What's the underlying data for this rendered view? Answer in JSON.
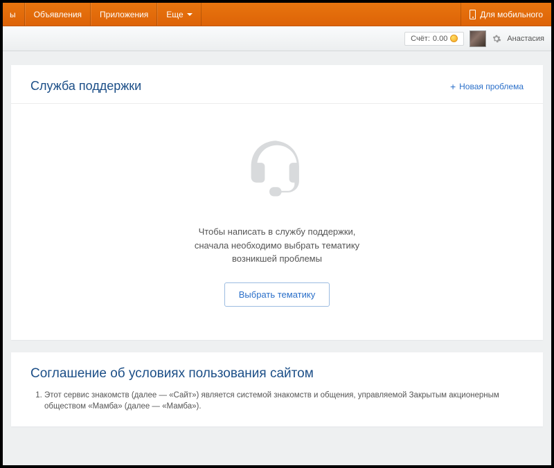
{
  "topnav": {
    "items": [
      "ы",
      "Объявления",
      "Приложения",
      "Еще"
    ],
    "mobile_label": "Для мобильного"
  },
  "userbar": {
    "balance_label": "Счёт:",
    "balance_value": "0.00",
    "username": "Анастасия"
  },
  "support": {
    "title": "Служба поддержки",
    "new_issue_label": "Новая проблема",
    "body_line1": "Чтобы написать в службу поддержки,",
    "body_line2": "сначала необходимо выбрать тематику",
    "body_line3": "возникшей проблемы",
    "choose_button": "Выбрать тематику"
  },
  "agreement": {
    "title": "Соглашение об условиях пользования сайтом",
    "item1": "Этот сервис знакомств (далее — «Сайт») является системой знакомств и общения, управляемой Закрытым акционерным обществом «Мамба» (далее — «Мамба»)."
  }
}
